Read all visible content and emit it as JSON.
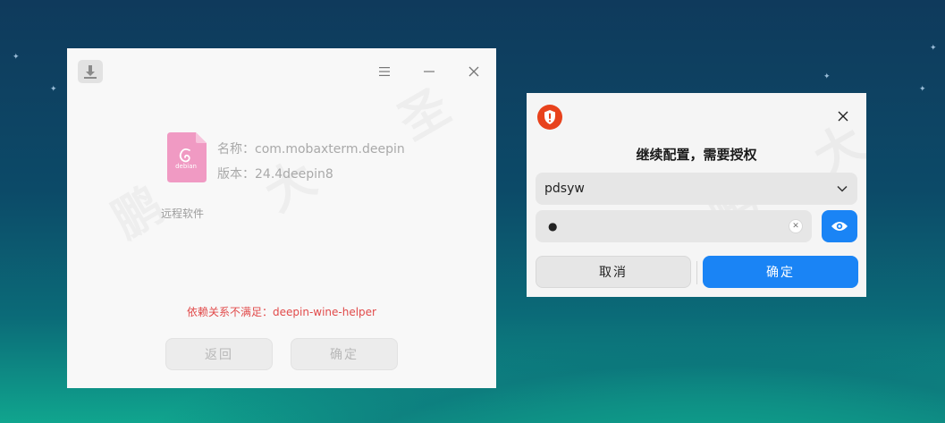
{
  "installer": {
    "package_name_label": "名称：",
    "package_name": "com.mobaxterm.deepin",
    "version_label": "版本：",
    "version": "24.4deepin8",
    "package_icon_text": "debian",
    "category": "远程软件",
    "dependency_error": "依赖关系不满足：deepin-wine-helper",
    "back_button": "返回",
    "confirm_button": "确定"
  },
  "auth_dialog": {
    "title": "继续配置，需要授权",
    "username": "pdsyw",
    "password_masked": "●",
    "cancel_button": "取消",
    "confirm_button": "确定"
  },
  "colors": {
    "accent": "#1a84f5",
    "error": "#e14a4a",
    "shield": "#e8421c",
    "package_icon": "#f09ac3"
  }
}
